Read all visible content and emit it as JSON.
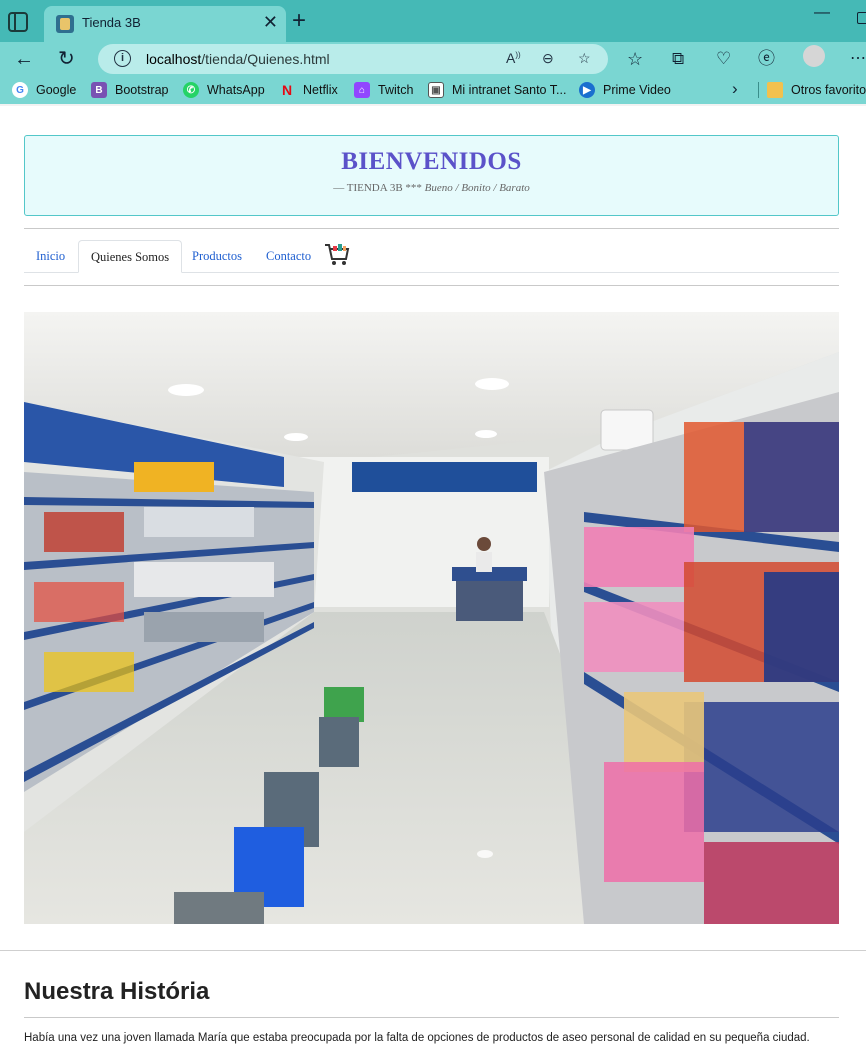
{
  "browser": {
    "tab_title": "Tienda 3B",
    "address_host": "localhost",
    "address_path": "/tienda/Quienes.html",
    "bookmarks": [
      {
        "label": "Google",
        "icon": "google-icon",
        "color": "#ffffff"
      },
      {
        "label": "Bootstrap",
        "icon": "bootstrap-icon",
        "color": "#7952b3"
      },
      {
        "label": "WhatsApp",
        "icon": "whatsapp-icon",
        "color": "#25d366"
      },
      {
        "label": "Netflix",
        "icon": "netflix-icon",
        "color": "#e50914"
      },
      {
        "label": "Twitch",
        "icon": "twitch-icon",
        "color": "#9146ff"
      },
      {
        "label": "Mi intranet Santo T...",
        "icon": "intranet-icon",
        "color": "#555555"
      },
      {
        "label": "Prime Video",
        "icon": "prime-video-icon",
        "color": "#1a98ff"
      }
    ],
    "other_favorites": "Otros favoritos",
    "accent_color": "#45b9b6"
  },
  "header": {
    "title": "BIENVENIDOS",
    "subtitle_prefix": "— TIENDA 3B ***",
    "subtitle_italic": "Bueno / Bonito / Barato",
    "title_color": "#5b52c9"
  },
  "nav": {
    "tabs": [
      {
        "label": "Inicio",
        "active": false
      },
      {
        "label": "Quienes Somos",
        "active": true
      },
      {
        "label": "Productos",
        "active": false
      },
      {
        "label": "Contacto",
        "active": false
      }
    ],
    "cart_icon": "shopping-cart-icon"
  },
  "story": {
    "heading": "Nuestra História",
    "text": "Había una vez una joven llamada María que estaba preocupada por la falta de opciones de productos de aseo personal de calidad en su pequeña ciudad."
  }
}
